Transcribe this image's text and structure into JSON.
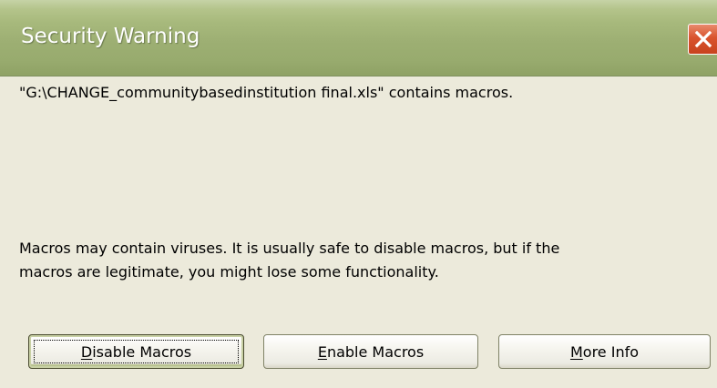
{
  "window": {
    "title": "Security Warning",
    "close_icon": "close-icon"
  },
  "message": {
    "file_notice": "\"G:\\CHANGE_communitybasedinstitution final.xls\" contains macros.",
    "warning_line1": "Macros may contain viruses. It is usually safe to disable macros, but if the",
    "warning_line2": "macros are legitimate, you might lose some functionality."
  },
  "buttons": {
    "disable": {
      "prefix": "",
      "accel": "D",
      "rest": "isable Macros"
    },
    "enable": {
      "prefix": "",
      "accel": "E",
      "rest": "nable Macros"
    },
    "info": {
      "prefix": "",
      "accel": "M",
      "rest": "ore Info"
    }
  },
  "colors": {
    "titlebar": "#98ab6e",
    "close_button": "#d9532e",
    "dialog_background": "#eceadb"
  }
}
